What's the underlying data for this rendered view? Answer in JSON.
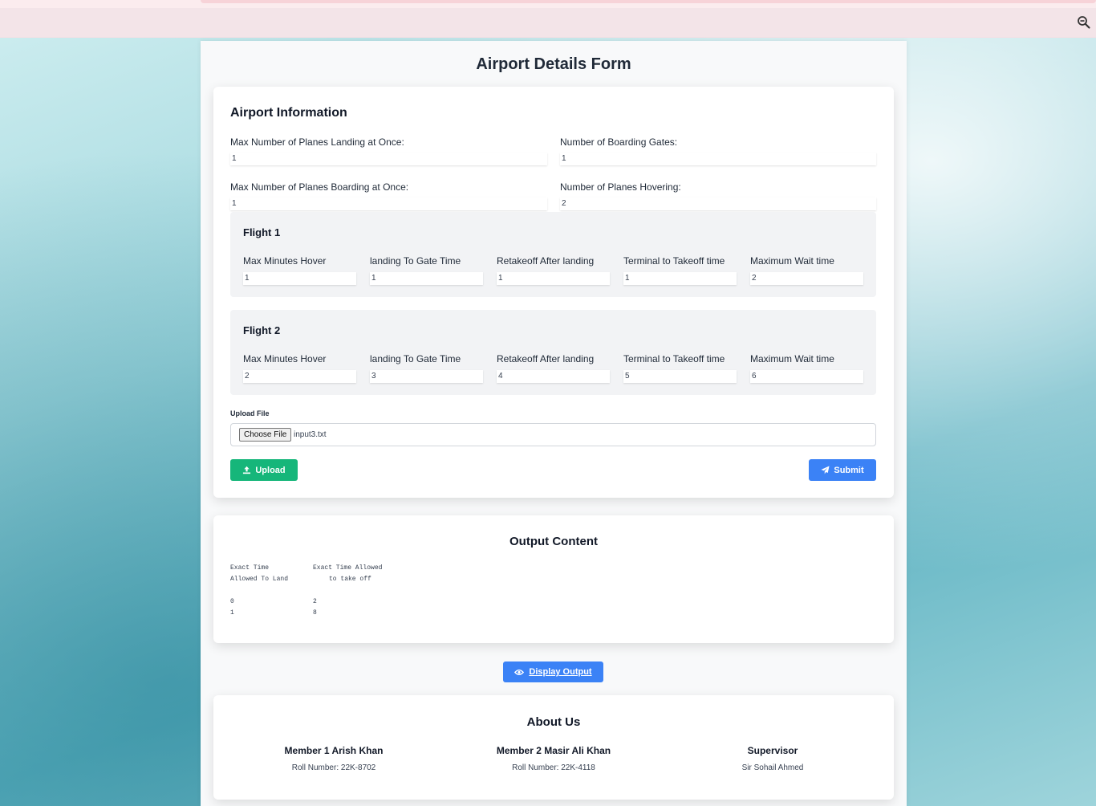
{
  "page": {
    "title": "Airport Details Form"
  },
  "airport": {
    "section_title": "Airport Information",
    "landing": {
      "label": "Max Number of Planes Landing at Once:",
      "value": "1"
    },
    "gates": {
      "label": "Number of Boarding Gates:",
      "value": "1"
    },
    "boarding": {
      "label": "Max Number of Planes Boarding at Once:",
      "value": "1"
    },
    "hovering": {
      "label": "Number of Planes Hovering:",
      "value": "2"
    }
  },
  "field_labels": {
    "hover": "Max Minutes Hover",
    "gate": "landing To Gate Time",
    "retakeoff": "Retakeoff After landing",
    "terminal": "Terminal to Takeoff time",
    "wait": "Maximum Wait time"
  },
  "flights": [
    {
      "title": "Flight 1",
      "hover": "1",
      "gate": "1",
      "retakeoff": "1",
      "terminal": "1",
      "wait": "2"
    },
    {
      "title": "Flight 2",
      "hover": "2",
      "gate": "3",
      "retakeoff": "4",
      "terminal": "5",
      "wait": "6"
    }
  ],
  "upload": {
    "label": "Upload File",
    "choose_label": "Choose File",
    "file_name": "input3.txt",
    "upload_button": "Upload",
    "submit_button": "Submit"
  },
  "output": {
    "title": "Output Content",
    "header_land_1": "Exact Time",
    "header_land_2": "Allowed To Land",
    "header_takeoff_1": "Exact Time Allowed",
    "header_takeoff_2": "to take off",
    "rows": [
      {
        "land": "0",
        "takeoff": "2"
      },
      {
        "land": "1",
        "takeoff": "8"
      }
    ],
    "display_button": "Display Output"
  },
  "about": {
    "title": "About Us",
    "members": [
      {
        "name": "Member 1 Arish Khan",
        "info": "Roll Number: 22K-8702"
      },
      {
        "name": "Member 2 Masir Ali Khan",
        "info": "Roll Number: 22K-4118"
      },
      {
        "name": "Supervisor",
        "info": "Sir Sohail Ahmed"
      }
    ]
  },
  "colors": {
    "upload_button": "#16b67a",
    "submit_button": "#3b82f6",
    "toolbar": "#f3e4e8"
  },
  "icons": {
    "zoom": "zoom-out-icon",
    "upload": "upload-icon",
    "submit": "paper-plane-icon",
    "display": "eye-icon"
  }
}
